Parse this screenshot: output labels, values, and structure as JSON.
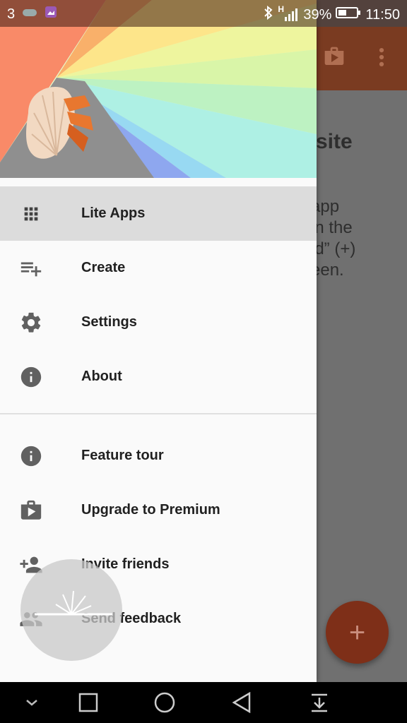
{
  "status_bar": {
    "notification_count": "3",
    "battery": "39%",
    "time": "11:50",
    "network": "H"
  },
  "background": {
    "title_fragment": "site",
    "text_fragment": "app\nin the\nld” (+)\neen."
  },
  "drawer": {
    "primary_items": [
      {
        "label": "Lite Apps",
        "icon": "apps-grid-icon",
        "active": true
      },
      {
        "label": "Create",
        "icon": "playlist-add-icon",
        "active": false
      },
      {
        "label": "Settings",
        "icon": "gear-icon",
        "active": false
      },
      {
        "label": "About",
        "icon": "info-icon",
        "active": false
      }
    ],
    "secondary_items": [
      {
        "label": "Feature tour",
        "icon": "info-icon"
      },
      {
        "label": "Upgrade to Premium",
        "icon": "shop-icon"
      },
      {
        "label": "Invite friends",
        "icon": "person-add-icon"
      },
      {
        "label": "Send feedback",
        "icon": "people-icon"
      }
    ]
  },
  "fab": {
    "label": "+"
  },
  "colors": {
    "toolbar": "#7a3b21",
    "fab": "#7e2f18",
    "drawer_bg": "#fafafa",
    "active_item": "#dcdcdc",
    "icon": "#616161"
  }
}
